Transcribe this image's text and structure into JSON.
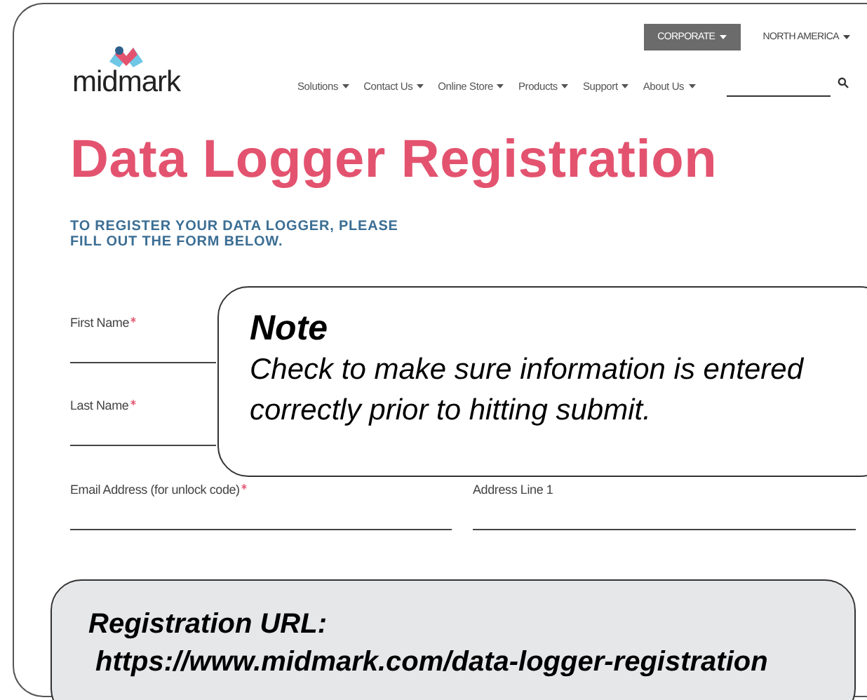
{
  "header": {
    "logo": "midmark",
    "region_buttons": [
      {
        "label": "CORPORATE",
        "selected": true
      },
      {
        "label": "NORTH AMERICA",
        "selected": false
      }
    ],
    "nav": [
      "Solutions",
      "Contact Us",
      "Online Store",
      "Products",
      "Support",
      "About Us"
    ]
  },
  "title": "Data Logger Registration",
  "intro": [
    "TO REGISTER YOUR DATA LOGGER, PLEASE",
    "FILL OUT THE FORM BELOW."
  ],
  "fields": [
    {
      "label": "First Name",
      "required": true
    },
    {
      "label": "Last Name",
      "required": true
    },
    {
      "label": "Email Address (for unlock code)",
      "required": true
    },
    {
      "label": "Address Line 1",
      "required": false
    }
  ],
  "note": {
    "heading": "Note",
    "text": "Check to make sure information is entered correctly prior to hitting submit."
  },
  "url_callout": {
    "label": "Registration URL:",
    "url": "https://www.midmark.com/data-logger-registration"
  }
}
